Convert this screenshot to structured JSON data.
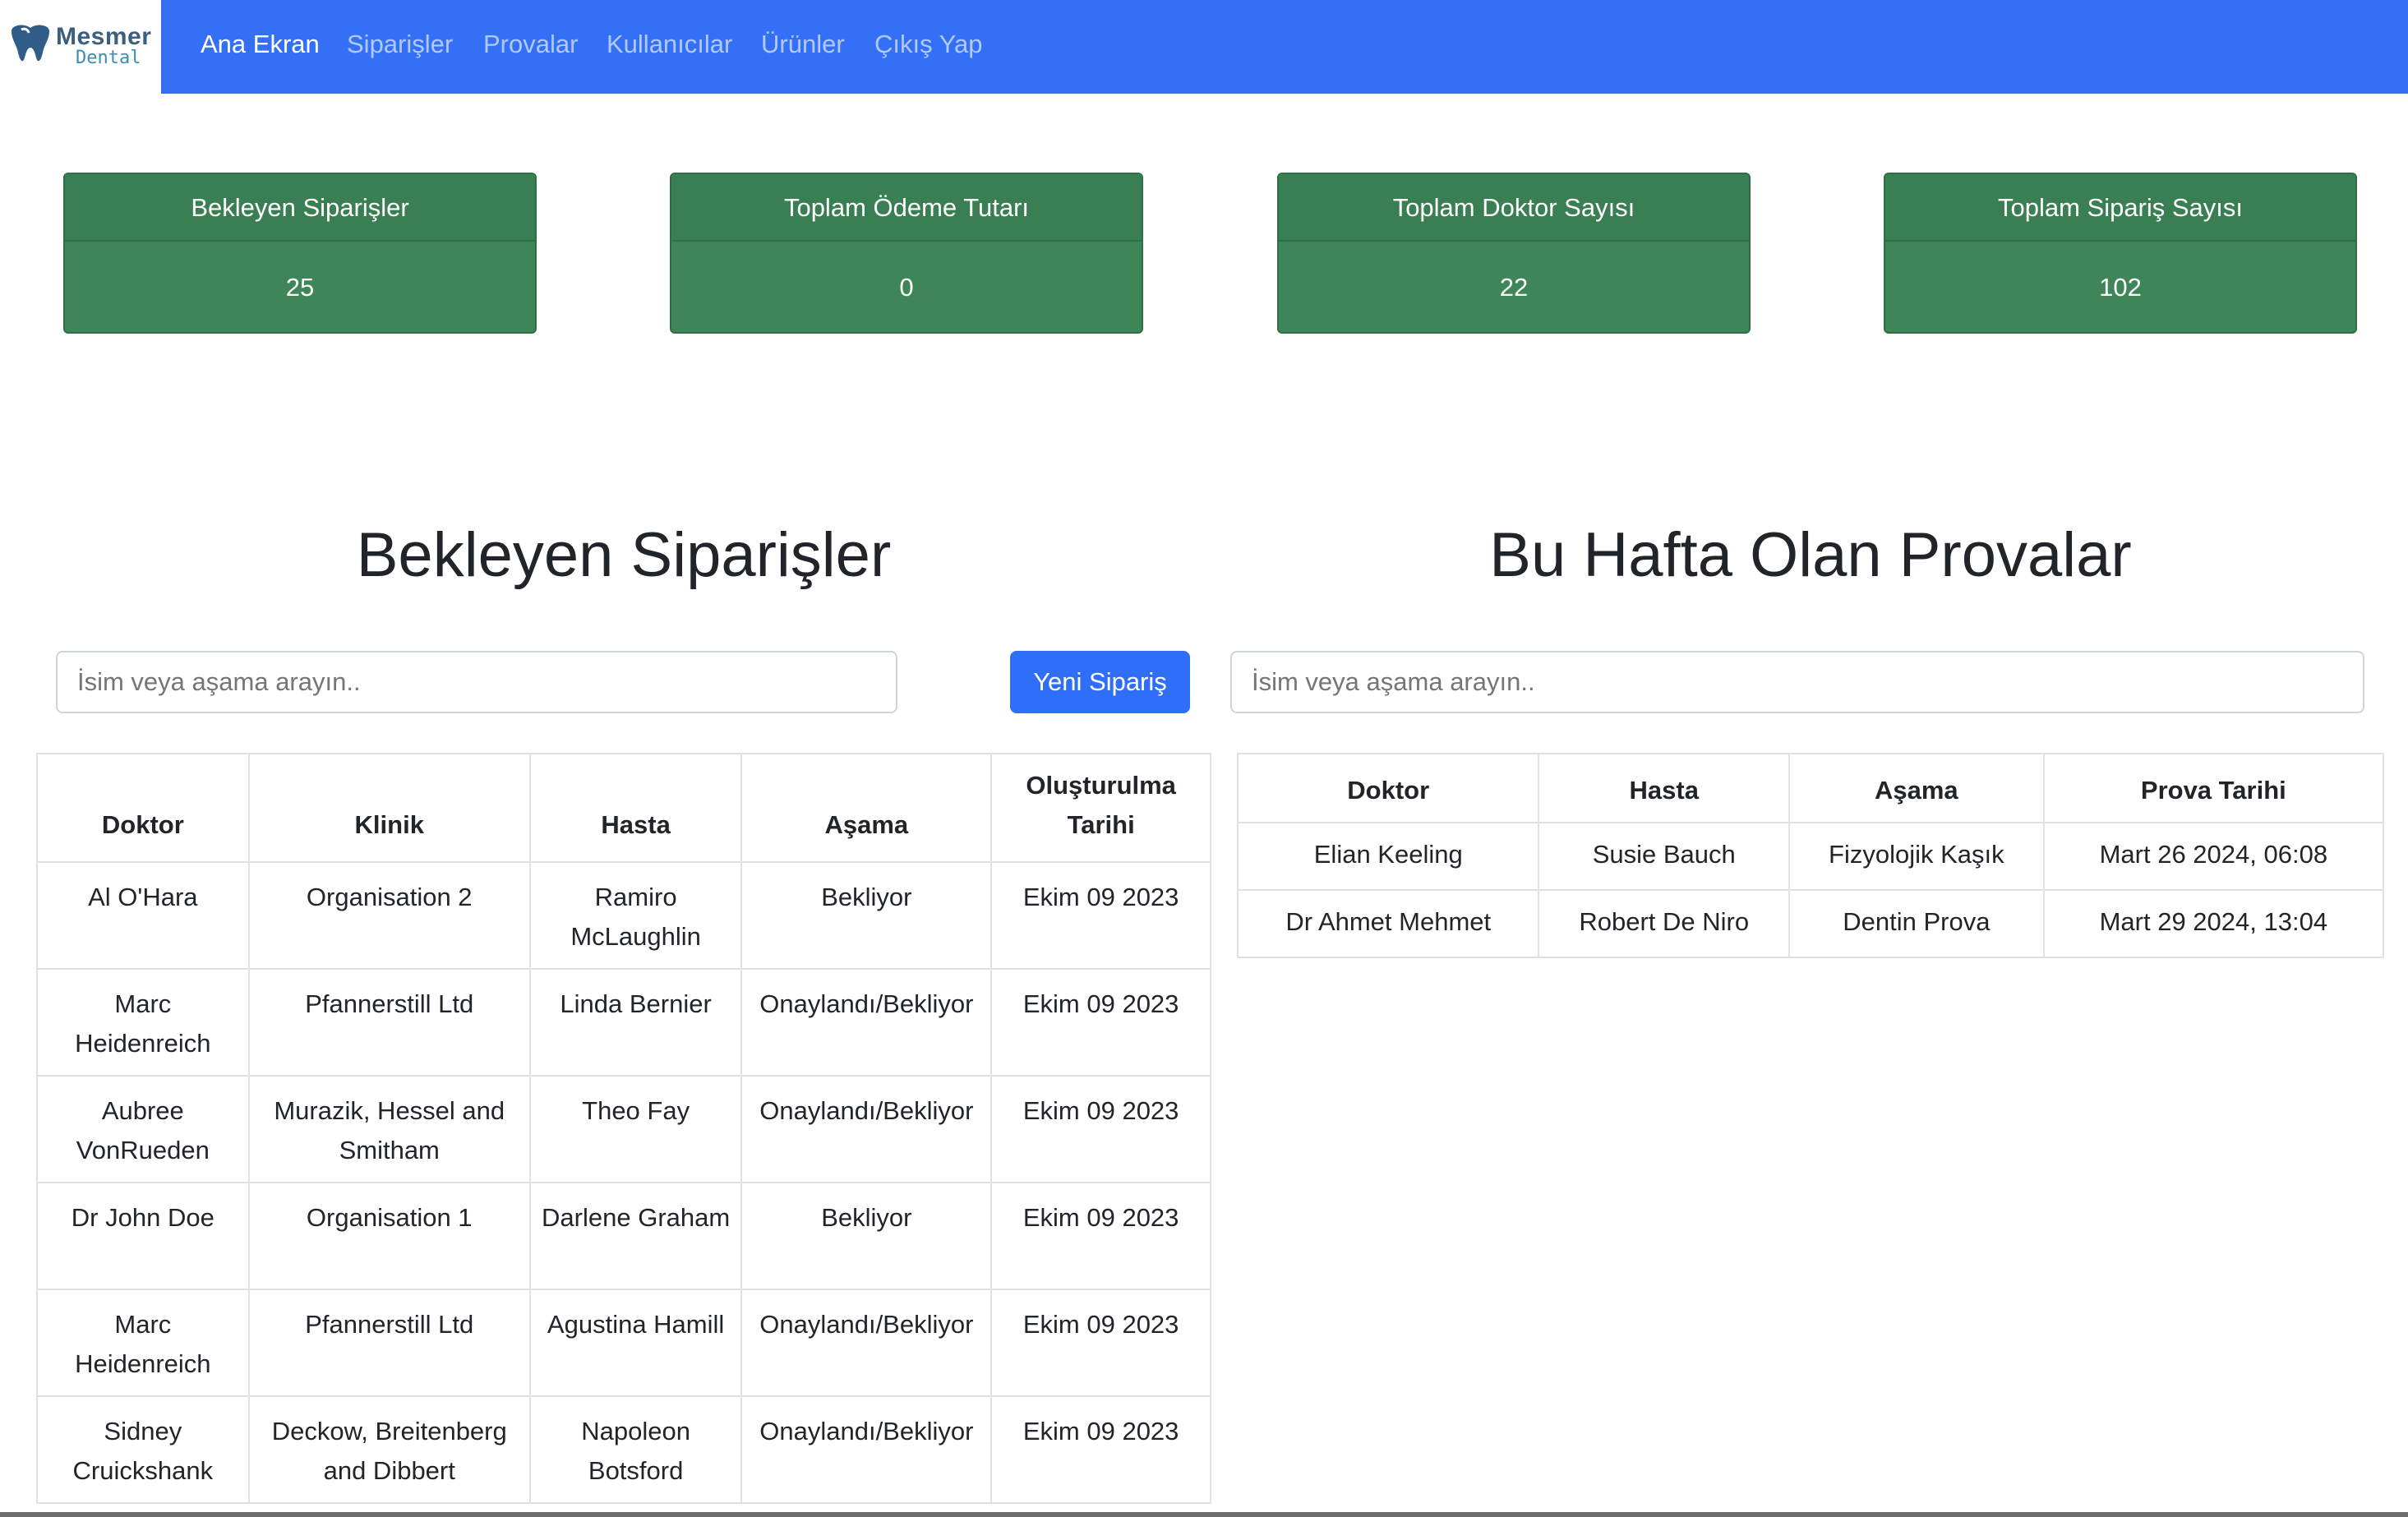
{
  "brand": {
    "name": "Mesmer",
    "sub": "Dental",
    "colors": {
      "tooth": "#2f5d86",
      "text": "#3b5f7d"
    }
  },
  "nav": {
    "items": [
      "Ana Ekran",
      "Siparişler",
      "Provalar",
      "Kullanıcılar",
      "Ürünler",
      "Çıkış Yap"
    ],
    "active_index": 0,
    "bg_color": "#3370f5"
  },
  "stats": [
    {
      "label": "Bekleyen Siparişler",
      "value": "25"
    },
    {
      "label": "Toplam Ödeme Tutarı",
      "value": "0"
    },
    {
      "label": "Toplam Doktor Sayısı",
      "value": "22"
    },
    {
      "label": "Toplam Sipariş Sayısı",
      "value": "102"
    }
  ],
  "stat_color": "#3e8657",
  "orders": {
    "title": "Bekleyen Siparişler",
    "search_placeholder": "İsim veya aşama arayın..",
    "new_button": "Yeni Sipariş",
    "columns": [
      "Doktor",
      "Klinik",
      "Hasta",
      "Aşama",
      "Oluşturulma Tarihi"
    ],
    "rows": [
      [
        "Al O'Hara",
        "Organisation 2",
        "Ramiro McLaughlin",
        "Bekliyor",
        "Ekim 09 2023"
      ],
      [
        "Marc Heidenreich",
        "Pfannerstill Ltd",
        "Linda Bernier",
        "Onaylandı/Bekliyor",
        "Ekim 09 2023"
      ],
      [
        "Aubree VonRueden",
        "Murazik, Hessel and Smitham",
        "Theo Fay",
        "Onaylandı/Bekliyor",
        "Ekim 09 2023"
      ],
      [
        "Dr John Doe",
        "Organisation 1",
        "Darlene Graham",
        "Bekliyor",
        "Ekim 09 2023"
      ],
      [
        "Marc Heidenreich",
        "Pfannerstill Ltd",
        "Agustina Hamill",
        "Onaylandı/Bekliyor",
        "Ekim 09 2023"
      ],
      [
        "Sidney Cruickshank",
        "Deckow, Breitenberg and Dibbert",
        "Napoleon Botsford",
        "Onaylandı/Bekliyor",
        "Ekim 09 2023"
      ]
    ]
  },
  "trials": {
    "title": "Bu Hafta Olan Provalar",
    "search_placeholder": "İsim veya aşama arayın..",
    "columns": [
      "Doktor",
      "Hasta",
      "Aşama",
      "Prova Tarihi"
    ],
    "rows": [
      [
        "Elian Keeling",
        "Susie Bauch",
        "Fizyolojik Kaşık",
        "Mart 26 2024, 06:08"
      ],
      [
        "Dr Ahmet Mehmet",
        "Robert De Niro",
        "Dentin Prova",
        "Mart 29 2024, 13:04"
      ]
    ]
  }
}
